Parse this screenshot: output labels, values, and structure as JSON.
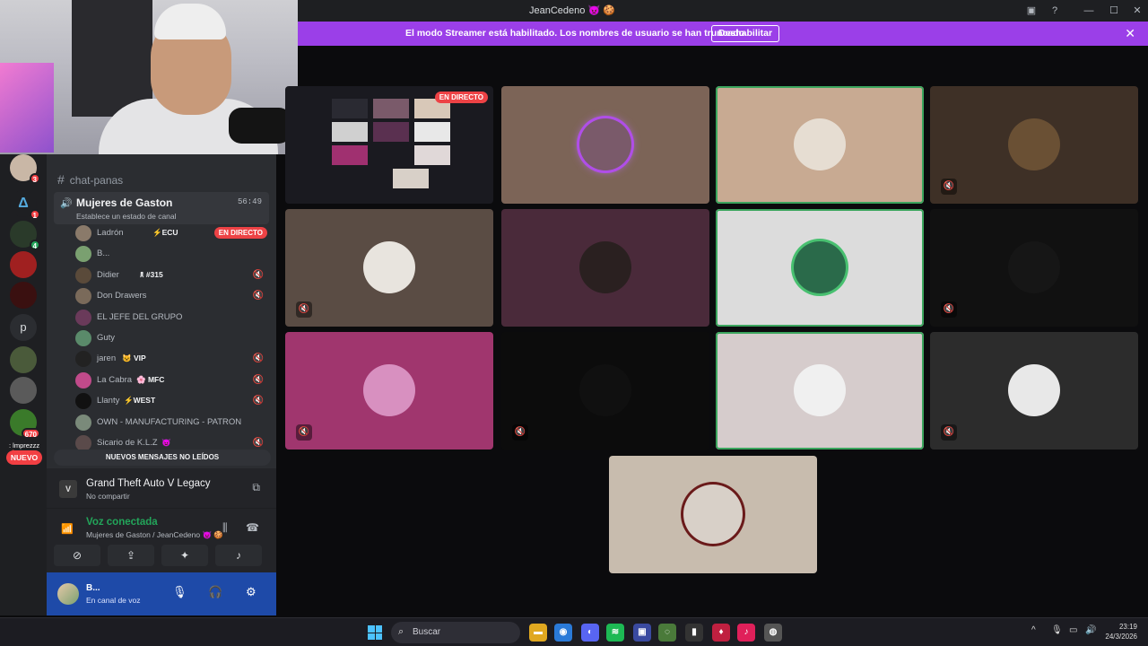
{
  "window": {
    "title": "JeanCedeno 👿 🍪"
  },
  "banner": {
    "message": "El modo Streamer está habilitado. Los nombres de usuario se han truncado.",
    "button": "Deshabilitar",
    "close": "✕"
  },
  "rail": {
    "badges": [
      "3",
      "1",
      "4",
      "670"
    ],
    "letter": "p",
    "nuevo": "NUEVO",
    "chat_peek": ": lmprezzz 🔥 zati"
  },
  "channels": {
    "text_channel": "chat-panas",
    "voice_channel": {
      "name": "Mujeres de Gaston",
      "status": "Establece un estado de canal",
      "timer": "56:49"
    },
    "members": [
      {
        "name": "Ladrón",
        "tag": "⚡ECU",
        "live": "EN DIRECTO",
        "color": "#8a7a6a"
      },
      {
        "name": "B...",
        "tag": "",
        "color": "#7aa070"
      },
      {
        "name": "Didier",
        "tag": "🕱 #315",
        "color": "#5a4a3a"
      },
      {
        "name": "Don Drawers",
        "tag": "",
        "color": "#7a6a5a"
      },
      {
        "name": "EL JEFE DEL GRUPO",
        "tag": "",
        "color": "#6a3a5a"
      },
      {
        "name": "Guty",
        "tag": "",
        "color": "#5a8a6a"
      },
      {
        "name": "jaren",
        "tag": "😺 VIP",
        "color": "#222"
      },
      {
        "name": "La Cabra",
        "tag": "🌸 MFC",
        "color": "#c04a8a"
      },
      {
        "name": "Llanty",
        "tag": "⚡WEST",
        "color": "#111"
      },
      {
        "name": "OWN - MANUFACTURING - PATRON",
        "tag": "",
        "color": "#7a8a7a"
      },
      {
        "name": "Sicario de K.L.Z",
        "tag": "👿",
        "color": "#5a4a4a"
      }
    ],
    "unread": "NUEVOS MENSAJES NO LEÍDOS"
  },
  "activity": {
    "game": "Grand Theft Auto V Legacy",
    "sub": "No compartir",
    "icon_text": "V"
  },
  "voice": {
    "status": "Voz conectada",
    "location": "Mujeres de Gaston / JeanCedeno 👿 🍪"
  },
  "user": {
    "name": "B...",
    "status": "En canal de voz"
  },
  "grid": {
    "live_badge": "EN DIRECTO"
  },
  "taskbar": {
    "search": "Buscar",
    "time": "23:19",
    "date": "24/3/2026"
  }
}
